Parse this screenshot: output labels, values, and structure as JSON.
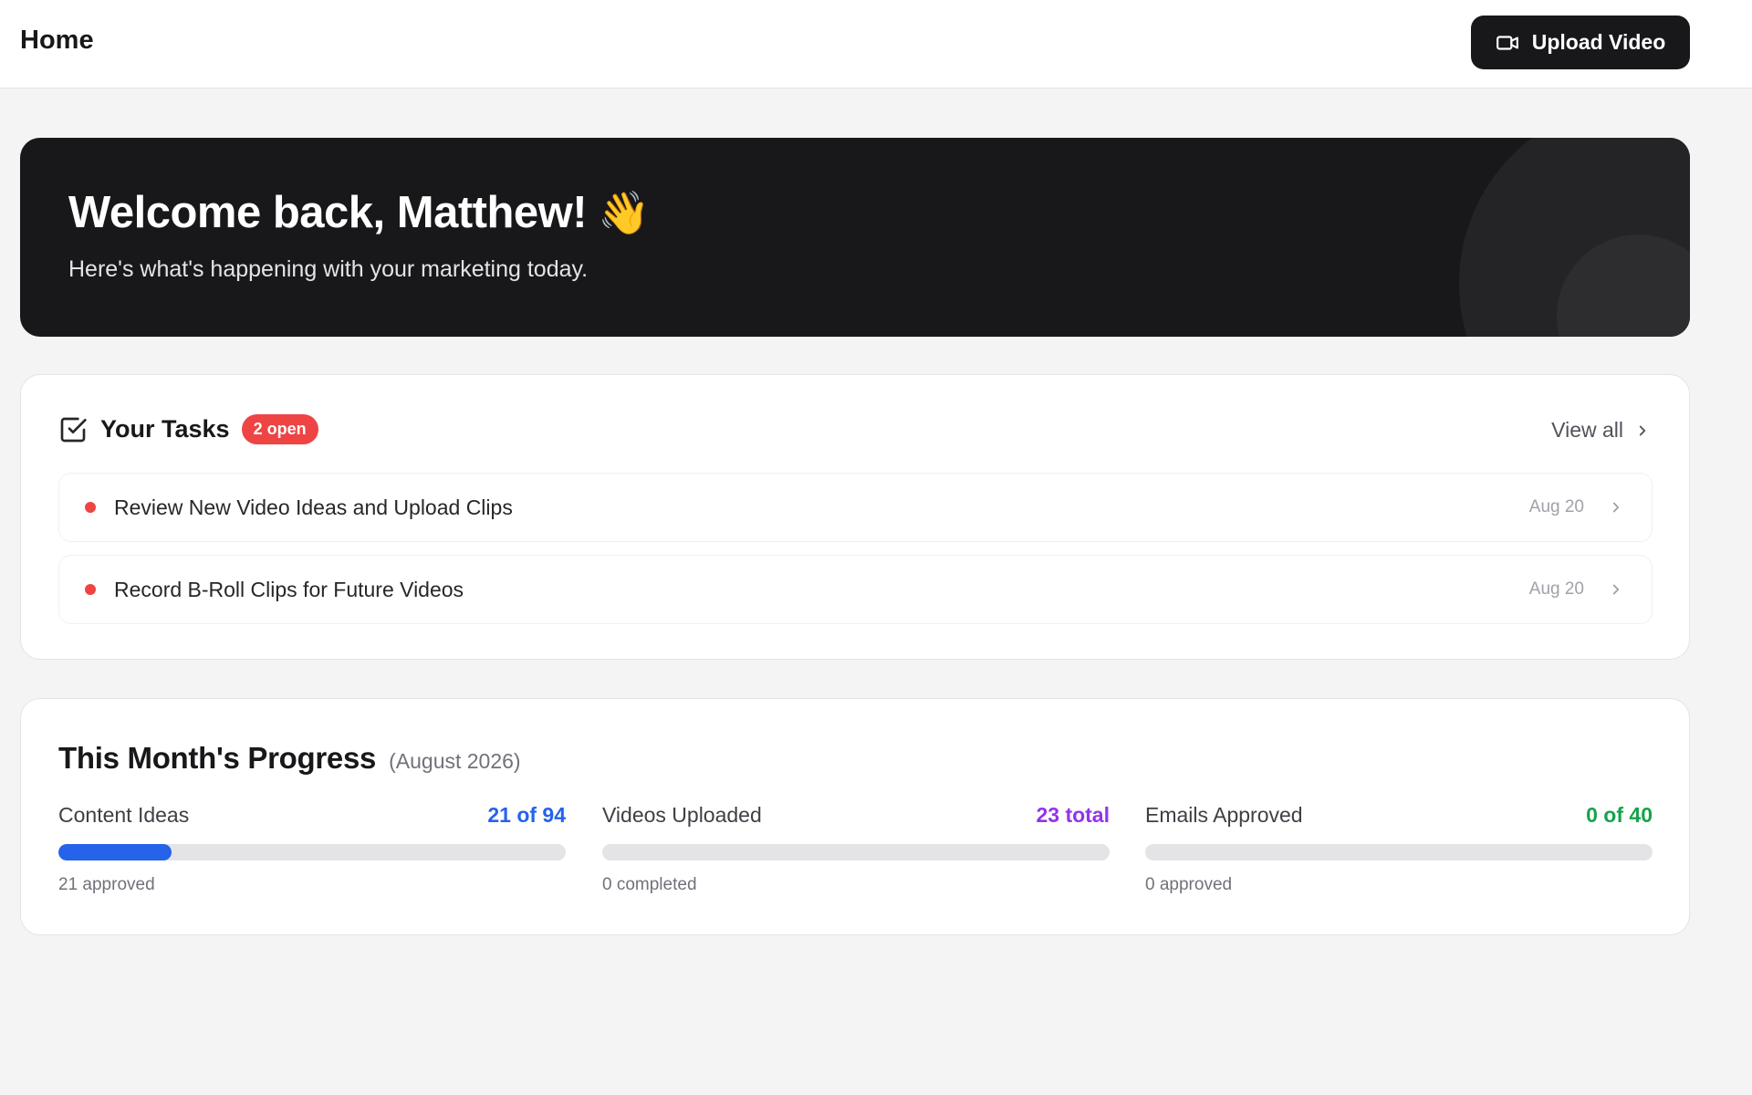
{
  "header": {
    "title": "Home",
    "upload_button_label": "Upload Video",
    "upload_button_icon": "video-camera-icon"
  },
  "hero": {
    "greeting": "Welcome back, Matthew!",
    "emoji": "👋",
    "subtitle": "Here's what's happening with your marketing today."
  },
  "tasks": {
    "icon": "checkbox-icon",
    "title": "Your Tasks",
    "badge": "2 open",
    "view_all_label": "View all",
    "items": [
      {
        "title": "Review New Video Ideas and Upload Clips",
        "date": "Aug 20"
      },
      {
        "title": "Record B-Roll Clips for Future Videos",
        "date": "Aug 20"
      }
    ]
  },
  "progress": {
    "title": "This Month's Progress",
    "period": "(August 2026)",
    "metrics": [
      {
        "label": "Content Ideas",
        "value": "21 of 94",
        "sub": "21 approved",
        "fraction": 0.2234,
        "color": "#2563eb"
      },
      {
        "label": "Videos Uploaded",
        "value": "23 total",
        "sub": "0 completed",
        "fraction": 0,
        "color": "#9333ea"
      },
      {
        "label": "Emails Approved",
        "value": "0 of 40",
        "sub": "0 approved",
        "fraction": 0,
        "color": "#16a34a"
      }
    ]
  },
  "colors": {
    "accent_dark": "#18181b",
    "badge_red": "#ef4444",
    "page_bg": "#f4f4f5"
  }
}
